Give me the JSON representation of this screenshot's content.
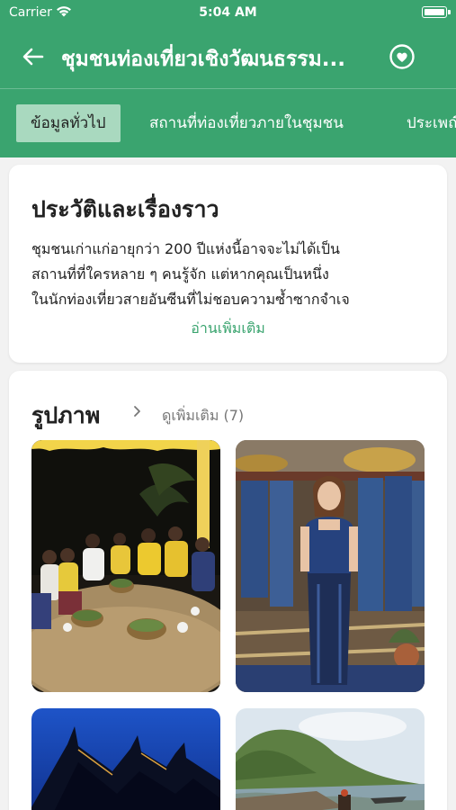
{
  "status_bar": {
    "carrier": "Carrier",
    "time": "5:04 AM"
  },
  "nav": {
    "title": "ชุมชนท่องเที่ยวเชิงวัฒนธรรม..."
  },
  "tabs": [
    {
      "label": "ข้อมูลทั่วไป",
      "active": true
    },
    {
      "label": "สถานที่ท่องเที่ยวภายในชุมชน",
      "active": false
    },
    {
      "label": "ประเพณี",
      "active": false
    }
  ],
  "history": {
    "title": "ประวัติและเรื่องราว",
    "lines": [
      "ชุมชนเก่าแก่อายุกว่า 200 ปีแห่งนี้อาจจะไม่ได้เป็น",
      "สถานที่ที่ใครหลาย ๆ คนรู้จัก แต่หากคุณเป็นหนึ่ง",
      "ในนักท่องเที่ยวสายอันซีนที่ไม่ชอบความซ้ำซากจำเจ"
    ],
    "read_more": "อ่านเพิ่มเติม"
  },
  "photos": {
    "title": "รูปภาพ",
    "see_more": "ดูเพิ่มเติม (7)"
  },
  "colors": {
    "brand": "#3aa46f",
    "tab_active": "#a9d9bf"
  },
  "icons": [
    "wifi-icon",
    "battery-icon",
    "back-arrow-icon",
    "heart-icon",
    "chevron-right-icon"
  ]
}
